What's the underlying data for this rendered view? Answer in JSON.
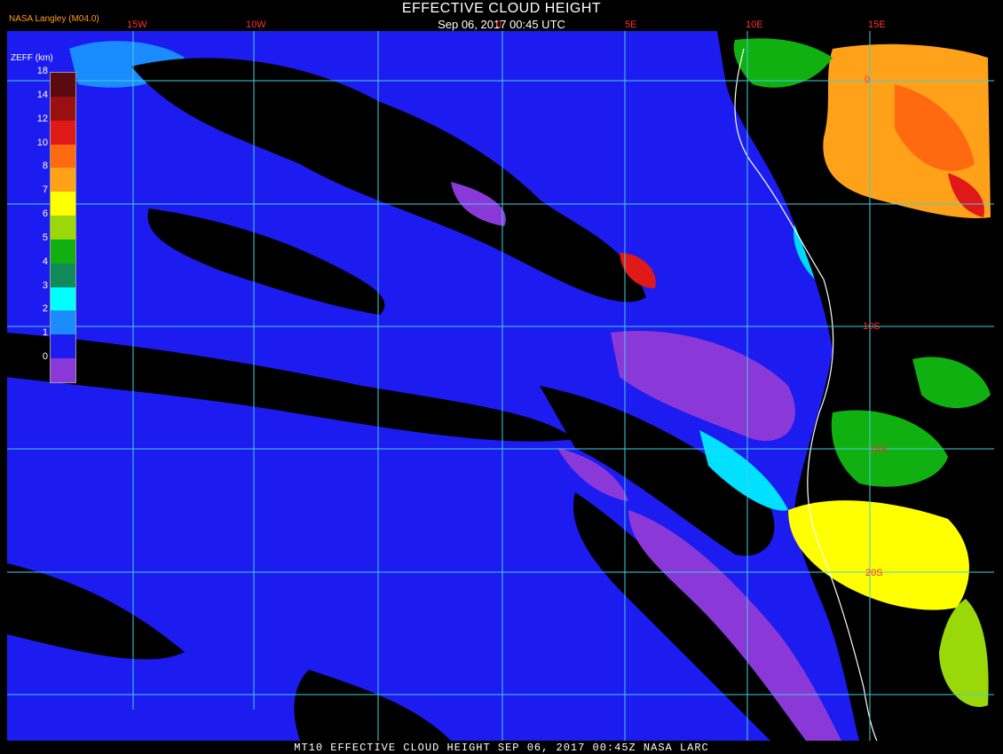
{
  "header": {
    "title": "EFFECTIVE CLOUD HEIGHT",
    "subtitle": "Sep 06, 2017 00:45 UTC",
    "credit": "NASA Langley (M04.0)"
  },
  "footer": {
    "text": "MT10  EFFECTIVE CLOUD HEIGHT   SEP 06, 2017 00:45Z   NASA LARC"
  },
  "lon_labels": [
    "15W",
    "10W",
    "0",
    "5E",
    "10E",
    "15E"
  ],
  "lat_labels": [
    "0",
    "10S",
    "15S",
    "20S"
  ],
  "legend": {
    "title": "ZEFF (km)",
    "levels": [
      {
        "label": "18",
        "color": "#5a0a10"
      },
      {
        "label": "14",
        "color": "#9a1010"
      },
      {
        "label": "12",
        "color": "#e01818"
      },
      {
        "label": "10",
        "color": "#ff6a10"
      },
      {
        "label": "8",
        "color": "#ffa21a"
      },
      {
        "label": "7",
        "color": "#ffff00"
      },
      {
        "label": "6",
        "color": "#9ad80a"
      },
      {
        "label": "5",
        "color": "#10b010"
      },
      {
        "label": "4",
        "color": "#108a5a"
      },
      {
        "label": "3",
        "color": "#00ffff"
      },
      {
        "label": "2",
        "color": "#1a8cff"
      },
      {
        "label": "1",
        "color": "#1c1cf0"
      },
      {
        "label": "0",
        "color": "#8a38d8"
      }
    ]
  },
  "colors": {
    "ocean_low_cloud": "#1c1cf0",
    "clear": "#000000",
    "grid": "#40d0e0",
    "coast": "#ffffff"
  }
}
